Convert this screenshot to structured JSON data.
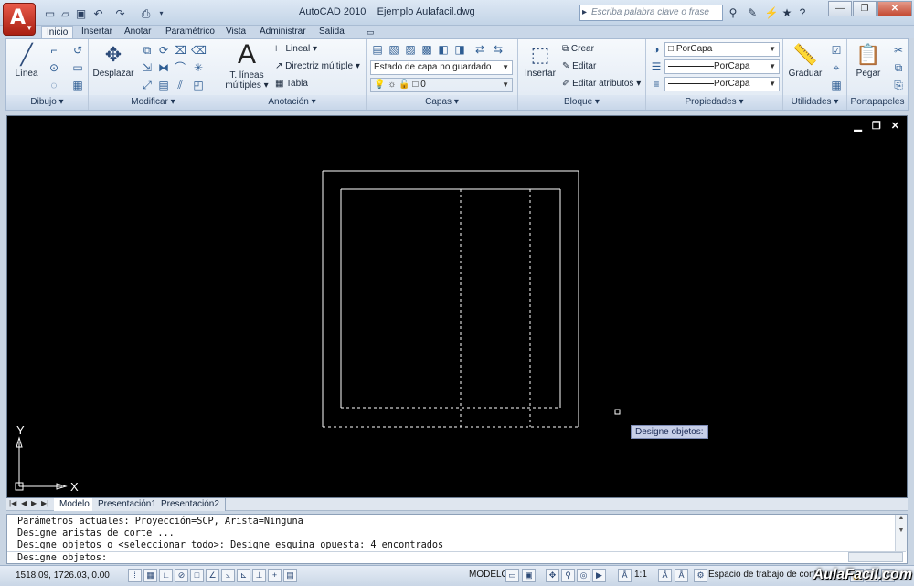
{
  "titlebar": {
    "app_title": "AutoCAD 2010",
    "document_title": "Ejemplo Aulafacil.dwg",
    "search_placeholder": "Escriba palabra clave o frase"
  },
  "ribbon_tabs": [
    "Inicio",
    "Insertar",
    "Anotar",
    "Paramétrico",
    "Vista",
    "Administrar",
    "Salida"
  ],
  "active_tab": "Inicio",
  "panels": {
    "dibujo": {
      "title": "Dibujo",
      "linea_label": "Línea"
    },
    "modificar": {
      "title": "Modificar",
      "desplazar_label": "Desplazar"
    },
    "anotacion": {
      "title": "Anotación",
      "text_big_glyph": "A",
      "text_label_1": "T. líneas",
      "text_label_2": "múltiples",
      "lineal_label": "Lineal",
      "directriz_label": "Directriz múltiple",
      "tabla_label": "Tabla"
    },
    "capas": {
      "title": "Capas",
      "layer_state": "Estado de capa no guardado",
      "current_layer": "0"
    },
    "bloque": {
      "title": "Bloque",
      "insertar_label": "Insertar",
      "crear_label": "Crear",
      "editar_label": "Editar",
      "editar_atributos_label": "Editar atributos"
    },
    "propiedades": {
      "title": "Propiedades",
      "color": "PorCapa",
      "linetype": "PorCapa",
      "lineweight": "PorCapa"
    },
    "utilidades": {
      "title": "Utilidades",
      "graduar_label": "Graduar"
    },
    "portapapeles": {
      "title": "Portapapeles",
      "pegar_label": "Pegar"
    }
  },
  "drawing": {
    "tooltip": "Designe objetos:",
    "ucs_x": "X",
    "ucs_y": "Y"
  },
  "layout_tabs": [
    "Modelo",
    "Presentación1",
    "Presentación2"
  ],
  "active_layout": "Modelo",
  "command_history": [
    "Parámetros actuales: Proyección=SCP, Arista=Ninguna",
    "Designe aristas de corte ...",
    "Designe objetos o <seleccionar todo>: Designe esquina opuesta: 4 encontrados"
  ],
  "command_prompt": "Designe objetos:",
  "statusbar": {
    "coordinates": "1518.09, 1726.03, 0.00",
    "model_label": "MODELO",
    "scale": "1:1",
    "workspace": "Espacio de trabajo de configura"
  },
  "watermark": "AulaFacil.com",
  "colors": {
    "drawing_background": "#000000",
    "accent": "#c8321f"
  }
}
